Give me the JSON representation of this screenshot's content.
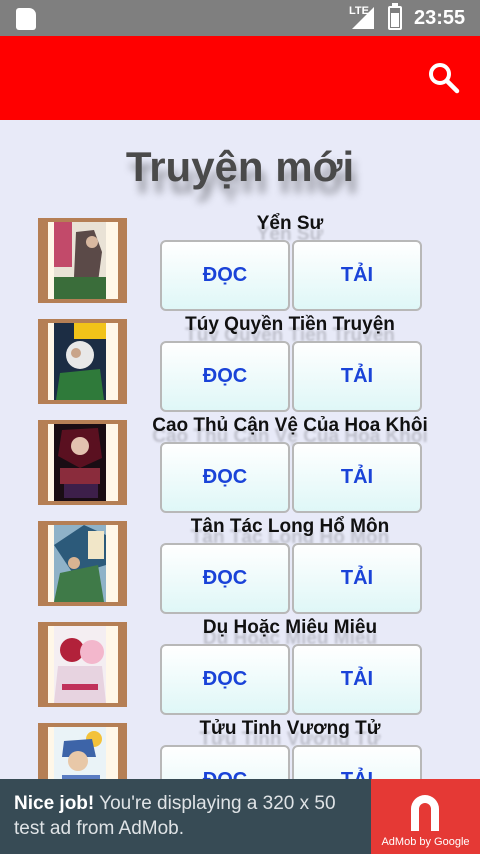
{
  "status_bar": {
    "network": "LTE",
    "time": "23:55"
  },
  "app_bar": {
    "search_icon": "search-icon",
    "color": "#ff0000"
  },
  "page": {
    "title": "Truyện mới"
  },
  "stories": [
    {
      "name": "Yển Sư",
      "read_label": "ĐỌC",
      "download_label": "TẢI"
    },
    {
      "name": "Túy Quyền Tiền Truyện",
      "read_label": "ĐỌC",
      "download_label": "TẢI"
    },
    {
      "name": "Cao Thủ Cận Vệ Của Hoa Khôi",
      "read_label": "ĐỌC",
      "download_label": "TẢI"
    },
    {
      "name": "Tân Tác Long Hổ Môn",
      "read_label": "ĐỌC",
      "download_label": "TẢI"
    },
    {
      "name": "Dụ Hoặc Miêu Miêu",
      "read_label": "ĐỌC",
      "download_label": "TẢI"
    },
    {
      "name": "Tửu Tinh Vương Tử",
      "read_label": "ĐỌC",
      "download_label": "TẢI"
    }
  ],
  "ad": {
    "headline": "Nice job!",
    "body": "You're displaying a 320 x 50 test ad from AdMob.",
    "brand": "AdMob by Google"
  }
}
